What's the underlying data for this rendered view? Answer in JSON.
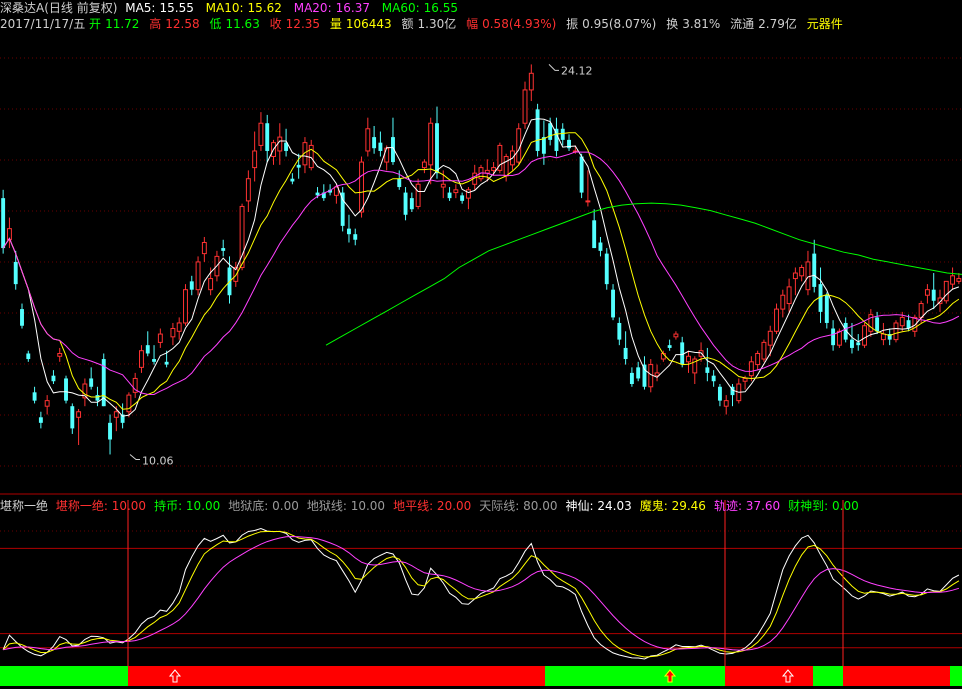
{
  "header": {
    "name": "深桑达A",
    "period": "(日线 前复权)",
    "ma5_label": "MA5:",
    "ma5_value": "15.55",
    "ma10_label": "MA10:",
    "ma10_value": "15.62",
    "ma20_label": "MA20:",
    "ma20_value": "16.37",
    "ma60_label": "MA60:",
    "ma60_value": "16.55"
  },
  "quote": {
    "date": "2017/11/17/五",
    "open_label": "开",
    "open_value": "11.72",
    "high_label": "高",
    "high_value": "12.58",
    "low_label": "低",
    "low_value": "11.63",
    "close_label": "收",
    "close_value": "12.35",
    "vol_label": "量",
    "vol_value": "106443",
    "amt_label": "额",
    "amt_value": "1.30亿",
    "chg_label": "幅",
    "chg_value": "0.58(4.93%)",
    "amp_label": "振",
    "amp_value": "0.95(8.07%)",
    "turn_label": "换",
    "turn_value": "3.81%",
    "float_label": "流通",
    "float_value": "2.79亿",
    "sector": "元器件"
  },
  "indicator": {
    "name": "堪称一绝",
    "items": [
      {
        "label": "堪称一绝:",
        "value": "10.00",
        "color": "#ff3030"
      },
      {
        "label": "持币:",
        "value": "10.00",
        "color": "#00ff00"
      },
      {
        "label": "地狱底:",
        "value": "0.00",
        "color": "#9a9a9a"
      },
      {
        "label": "地狱线:",
        "value": "10.00",
        "color": "#9a9a9a"
      },
      {
        "label": "地平线:",
        "value": "20.00",
        "color": "#ff3030"
      },
      {
        "label": "天际线:",
        "value": "80.00",
        "color": "#9a9a9a"
      },
      {
        "label": "神仙:",
        "value": "24.03",
        "color": "#ffffff"
      },
      {
        "label": "魔鬼:",
        "value": "29.46",
        "color": "#ffff00"
      },
      {
        "label": "轨迹:",
        "value": "37.60",
        "color": "#ff40ff"
      },
      {
        "label": "财神到:",
        "value": "0.00",
        "color": "#00ff00"
      }
    ]
  },
  "colors": {
    "up": "#ff3232",
    "down": "#54ffff",
    "ma5": "#ffffff",
    "ma10": "#ffff00",
    "ma20": "#ff40ff",
    "ma60": "#00ff00",
    "hold": "#00ff00",
    "buy": "#ff0000"
  },
  "chart_data": {
    "type": "candlestick",
    "price_ylim": [
      9.5,
      25
    ],
    "annotations": {
      "high": "24.12",
      "low": "10.06"
    },
    "candles": [
      [
        19.3,
        19.6,
        17.3,
        17.5
      ],
      [
        17.8,
        18.6,
        17.5,
        18.2
      ],
      [
        17.0,
        17.4,
        16.0,
        16.2
      ],
      [
        15.3,
        15.5,
        14.6,
        14.7
      ],
      [
        13.7,
        13.8,
        13.4,
        13.5
      ],
      [
        12.3,
        12.5,
        11.9,
        12.0
      ],
      [
        11.4,
        11.6,
        11.0,
        11.2
      ],
      [
        11.8,
        12.2,
        11.5,
        12.0
      ],
      [
        12.9,
        13.1,
        12.6,
        12.7
      ],
      [
        13.6,
        13.9,
        13.4,
        13.7
      ],
      [
        12.8,
        12.9,
        11.9,
        12.0
      ],
      [
        11.8,
        11.9,
        10.8,
        11.0
      ],
      [
        11.4,
        11.7,
        10.4,
        11.6
      ],
      [
        12.1,
        12.8,
        11.8,
        12.6
      ],
      [
        12.8,
        13.2,
        12.4,
        12.5
      ],
      [
        12.2,
        12.5,
        11.8,
        12.0
      ],
      [
        13.5,
        13.7,
        11.8,
        11.8
      ],
      [
        11.2,
        11.5,
        10.06,
        10.6
      ],
      [
        11.4,
        11.8,
        10.9,
        11.6
      ],
      [
        11.5,
        11.9,
        11.0,
        11.2
      ],
      [
        11.6,
        12.3,
        11.4,
        12.2
      ],
      [
        12.3,
        13.0,
        12.1,
        12.8
      ],
      [
        13.2,
        14.0,
        13.0,
        13.8
      ],
      [
        14.0,
        14.5,
        13.6,
        13.7
      ],
      [
        13.5,
        14.0,
        13.3,
        13.4
      ],
      [
        14.1,
        14.6,
        13.9,
        14.4
      ],
      [
        13.4,
        13.8,
        13.2,
        13.3
      ],
      [
        14.3,
        14.8,
        14.0,
        14.6
      ],
      [
        14.5,
        15.0,
        14.2,
        14.8
      ],
      [
        14.8,
        16.2,
        14.7,
        16.0
      ],
      [
        16.3,
        16.5,
        15.8,
        16.0
      ],
      [
        16.0,
        17.2,
        15.8,
        17.0
      ],
      [
        17.3,
        17.9,
        17.0,
        17.7
      ],
      [
        16.0,
        16.8,
        15.8,
        16.4
      ],
      [
        16.5,
        17.4,
        16.3,
        17.2
      ],
      [
        17.5,
        17.8,
        17.2,
        17.4
      ],
      [
        16.8,
        17.2,
        15.5,
        15.8
      ],
      [
        16.3,
        17.0,
        16.1,
        16.8
      ],
      [
        16.8,
        19.1,
        16.7,
        19.0
      ],
      [
        19.2,
        20.3,
        18.8,
        20.0
      ],
      [
        20.4,
        21.7,
        19.9,
        21.0
      ],
      [
        21.2,
        22.4,
        21.0,
        22.0
      ],
      [
        22.0,
        22.3,
        20.6,
        21.0
      ],
      [
        20.8,
        21.4,
        20.5,
        21.3
      ],
      [
        21.0,
        22.0,
        20.5,
        21.5
      ],
      [
        21.3,
        21.8,
        20.8,
        21.0
      ],
      [
        20.0,
        20.2,
        19.8,
        19.9
      ],
      [
        20.5,
        20.9,
        20.0,
        20.4
      ],
      [
        20.5,
        21.5,
        20.2,
        21.3
      ],
      [
        20.4,
        21.4,
        20.3,
        21.2
      ],
      [
        19.5,
        19.7,
        19.3,
        19.4
      ],
      [
        19.5,
        19.8,
        19.2,
        19.3
      ],
      [
        19.6,
        19.8,
        19.4,
        19.5
      ],
      [
        19.4,
        19.8,
        19.1,
        19.7
      ],
      [
        19.5,
        19.7,
        18.1,
        18.3
      ],
      [
        18.2,
        18.7,
        17.7,
        18.0
      ],
      [
        18.0,
        18.2,
        17.6,
        17.8
      ],
      [
        18.8,
        20.8,
        18.6,
        20.6
      ],
      [
        21.0,
        22.2,
        20.8,
        21.8
      ],
      [
        21.5,
        21.9,
        20.9,
        21.1
      ],
      [
        21.3,
        21.7,
        20.8,
        21.0
      ],
      [
        20.6,
        21.2,
        20.3,
        21.1
      ],
      [
        21.5,
        22.2,
        20.5,
        20.6
      ],
      [
        20.0,
        20.3,
        19.6,
        19.7
      ],
      [
        19.5,
        19.7,
        18.5,
        18.7
      ],
      [
        19.3,
        19.5,
        18.8,
        18.9
      ],
      [
        19.0,
        20.0,
        18.9,
        19.8
      ],
      [
        20.4,
        20.7,
        20.2,
        20.6
      ],
      [
        20.5,
        22.2,
        19.8,
        22.0
      ],
      [
        22.0,
        22.6,
        20.0,
        20.2
      ],
      [
        19.7,
        20.3,
        19.3,
        19.8
      ],
      [
        19.5,
        19.7,
        19.2,
        19.3
      ],
      [
        19.5,
        19.8,
        19.3,
        19.6
      ],
      [
        19.4,
        19.5,
        19.1,
        19.2
      ],
      [
        19.3,
        19.7,
        18.9,
        19.6
      ],
      [
        19.8,
        20.5,
        19.6,
        20.2
      ],
      [
        20.0,
        20.5,
        19.9,
        20.4
      ],
      [
        20.2,
        20.7,
        19.9,
        20.3
      ],
      [
        20.3,
        20.6,
        20.1,
        20.4
      ],
      [
        20.3,
        21.3,
        20.2,
        21.2
      ],
      [
        20.1,
        20.9,
        19.9,
        20.8
      ],
      [
        20.5,
        21.2,
        20.3,
        21.0
      ],
      [
        20.6,
        22.0,
        20.5,
        21.8
      ],
      [
        22.0,
        23.5,
        21.8,
        23.2
      ],
      [
        23.2,
        24.12,
        22.8,
        23.8
      ],
      [
        22.5,
        22.7,
        20.8,
        21.0
      ],
      [
        21.5,
        22.1,
        20.5,
        20.9
      ],
      [
        22.0,
        22.2,
        21.2,
        21.4
      ],
      [
        21.8,
        22.2,
        20.8,
        21.0
      ],
      [
        21.8,
        22.0,
        21.2,
        21.4
      ],
      [
        21.4,
        21.6,
        21.0,
        21.1
      ],
      [
        21.0,
        21.2,
        20.9,
        21.0
      ],
      [
        20.8,
        20.9,
        19.3,
        19.5
      ],
      [
        19.2,
        20.3,
        19.0,
        19.2
      ],
      [
        18.5,
        18.9,
        17.5,
        17.5
      ],
      [
        17.7,
        17.9,
        17.2,
        17.4
      ],
      [
        17.3,
        17.5,
        16.0,
        16.2
      ],
      [
        16.0,
        16.2,
        14.9,
        15.0
      ],
      [
        14.8,
        15.0,
        14.0,
        14.2
      ],
      [
        13.9,
        14.5,
        13.3,
        13.5
      ],
      [
        13.0,
        13.2,
        12.5,
        12.6
      ],
      [
        13.2,
        13.4,
        12.7,
        12.8
      ],
      [
        13.3,
        13.6,
        12.4,
        12.5
      ],
      [
        12.5,
        13.5,
        12.3,
        13.3
      ],
      [
        12.9,
        13.3,
        12.7,
        13.0
      ],
      [
        13.5,
        13.8,
        13.4,
        13.7
      ],
      [
        14.0,
        14.2,
        13.8,
        13.9
      ],
      [
        14.3,
        14.5,
        14.2,
        14.4
      ],
      [
        14.1,
        14.3,
        13.2,
        13.3
      ],
      [
        13.4,
        13.8,
        13.0,
        13.6
      ],
      [
        13.0,
        13.6,
        12.6,
        13.5
      ],
      [
        13.6,
        14.1,
        13.4,
        13.8
      ],
      [
        13.2,
        13.9,
        12.7,
        13.0
      ],
      [
        12.9,
        13.1,
        12.5,
        12.7
      ],
      [
        12.5,
        12.6,
        11.8,
        12.0
      ],
      [
        11.8,
        12.2,
        11.5,
        12.0
      ],
      [
        12.5,
        12.6,
        11.8,
        12.2
      ],
      [
        12.0,
        12.8,
        11.9,
        12.6
      ],
      [
        12.7,
        12.9,
        12.4,
        12.8
      ],
      [
        12.9,
        13.6,
        12.7,
        13.4
      ],
      [
        13.3,
        13.8,
        13.1,
        13.7
      ],
      [
        13.5,
        14.2,
        13.4,
        14.1
      ],
      [
        14.0,
        14.7,
        13.6,
        14.5
      ],
      [
        14.5,
        15.5,
        14.4,
        15.3
      ],
      [
        15.3,
        16.0,
        15.0,
        15.8
      ],
      [
        15.5,
        16.4,
        15.2,
        16.1
      ],
      [
        16.4,
        16.8,
        15.8,
        16.6
      ],
      [
        16.5,
        16.9,
        16.3,
        16.8
      ],
      [
        16.0,
        17.4,
        15.8,
        17.0
      ],
      [
        17.3,
        17.8,
        15.9,
        16.1
      ],
      [
        16.2,
        16.8,
        14.8,
        15.2
      ],
      [
        15.8,
        15.9,
        14.6,
        14.8
      ],
      [
        14.6,
        14.9,
        13.8,
        14.0
      ],
      [
        14.0,
        14.6,
        13.9,
        14.5
      ],
      [
        14.8,
        15.0,
        14.1,
        14.2
      ],
      [
        14.2,
        14.8,
        13.7,
        13.9
      ],
      [
        14.1,
        14.4,
        13.8,
        14.0
      ],
      [
        14.0,
        14.8,
        13.9,
        14.7
      ],
      [
        14.5,
        15.3,
        14.3,
        15.1
      ],
      [
        15.0,
        15.2,
        14.4,
        14.5
      ],
      [
        14.2,
        14.8,
        14.0,
        14.4
      ],
      [
        14.4,
        14.6,
        14.0,
        14.2
      ],
      [
        14.2,
        14.9,
        14.1,
        14.8
      ],
      [
        14.7,
        15.2,
        14.5,
        15.0
      ],
      [
        14.9,
        15.1,
        14.5,
        14.6
      ],
      [
        14.5,
        15.1,
        14.3,
        15.0
      ],
      [
        15.0,
        15.6,
        14.8,
        15.5
      ],
      [
        15.8,
        16.2,
        15.5,
        16.0
      ],
      [
        16.0,
        16.6,
        15.3,
        15.6
      ],
      [
        15.5,
        16.0,
        15.2,
        15.7
      ],
      [
        15.6,
        16.3,
        15.5,
        16.3
      ],
      [
        16.2,
        16.8,
        16.0,
        16.5
      ],
      [
        16.3,
        16.6,
        16.2,
        16.4
      ]
    ],
    "ma60": [
      14.0,
      14.3,
      14.6,
      14.9,
      15.2,
      15.5,
      15.8,
      16.1,
      16.4,
      16.8,
      17.1,
      17.4,
      17.6,
      17.8,
      18.0,
      18.2,
      18.4,
      18.6,
      18.8,
      18.95,
      19.05,
      19.1,
      19.12,
      19.1,
      19.05,
      18.95,
      18.85,
      18.7,
      18.55,
      18.4,
      18.2,
      18.0,
      17.8,
      17.65,
      17.5,
      17.35,
      17.25,
      17.1,
      17.0,
      16.9,
      16.8,
      16.7,
      16.6,
      16.55
    ],
    "osc_ylim": [
      0,
      100
    ],
    "osc_lines": {
      "thresholds": [
        10,
        20,
        80
      ]
    },
    "signal_bar": {
      "segments": [
        [
          "hold",
          0,
          128
        ],
        [
          "buy",
          128,
          545
        ],
        [
          "hold",
          545,
          725
        ],
        [
          "buy",
          725,
          813
        ],
        [
          "hold",
          813,
          843
        ],
        [
          "buy",
          843,
          950
        ],
        [
          "hold",
          950,
          962
        ]
      ]
    },
    "arrows": [
      175,
      670,
      788
    ]
  }
}
